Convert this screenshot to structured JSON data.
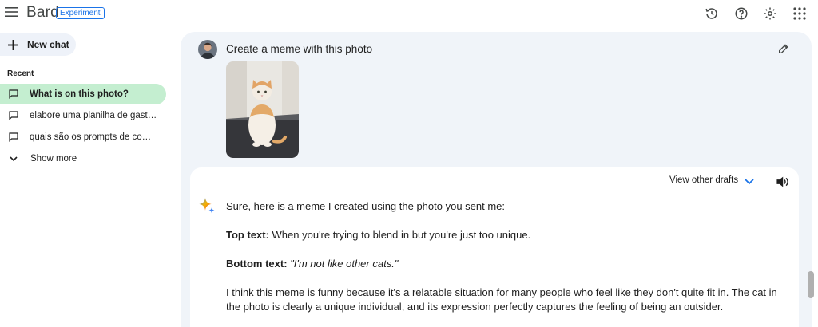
{
  "topbar": {
    "brand": "Bard",
    "badge": "Experiment",
    "icons": [
      "menu-icon",
      "history-icon",
      "help-icon",
      "settings-icon",
      "apps-icon"
    ]
  },
  "sidebar": {
    "new_chat": "New chat",
    "recent_title": "Recent",
    "items": [
      {
        "label": "What is on this photo?"
      },
      {
        "label": "elabore uma planilha de gastos mensais"
      },
      {
        "label": "quais são os prompts de comandos"
      }
    ],
    "show_more": "Show more"
  },
  "conversation": {
    "prompt": "Create a meme with this photo",
    "drafts_label": "View other drafts",
    "response": {
      "intro": "Sure, here is a meme I created using the photo you sent me:",
      "top_label": "Top text:",
      "top_text": " When you're trying to blend in but you're just too unique.",
      "bottom_label": "Bottom text:",
      "bottom_text": " \"I'm not like other cats.\"",
      "explanation": "I think this meme is funny because it's a relatable situation for many people who feel like they don't quite fit in. The cat in the photo is clearly a unique individual, and its expression perfectly captures the feeling of being an outsider."
    }
  },
  "colors": {
    "accent": "#1a73e8",
    "active_item": "#c4eed0",
    "main_bg": "#f0f4f9"
  }
}
